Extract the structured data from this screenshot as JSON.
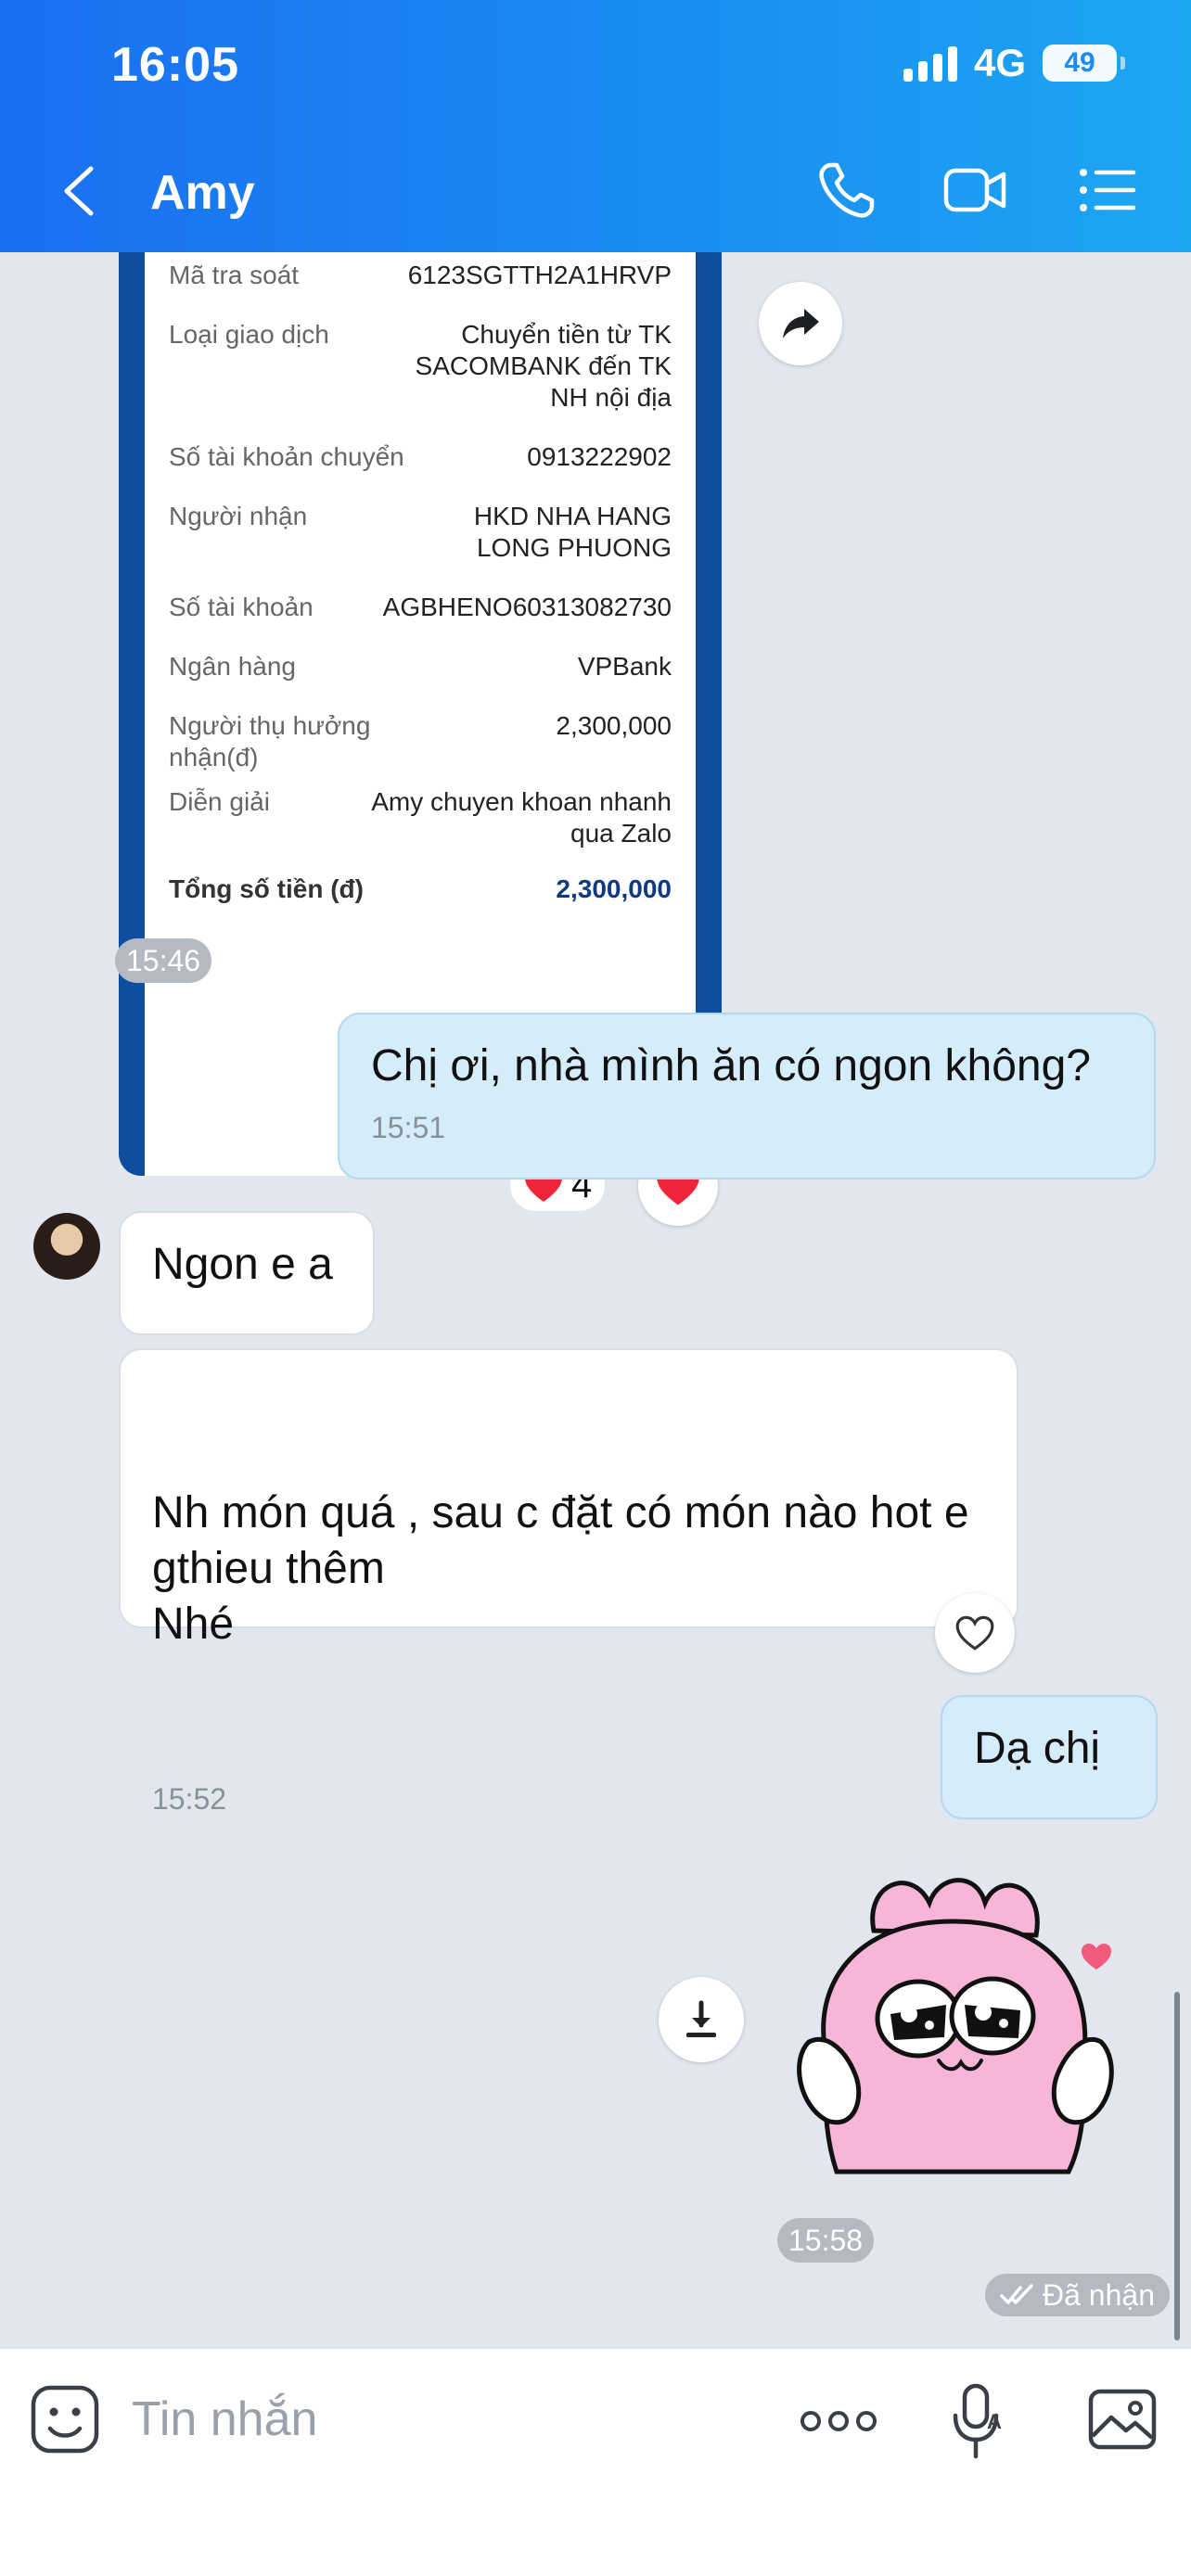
{
  "status_bar": {
    "time": "16:05",
    "network": "4G",
    "battery": "49"
  },
  "header": {
    "title": "Amy"
  },
  "receipt": {
    "rows": [
      {
        "label": "Mã tra soát",
        "value": "6123SGTTH2A1HRVP"
      },
      {
        "label": "Loại giao dịch",
        "value": "Chuyển tiền từ TK SACOMBANK đến TK NH nội địa"
      },
      {
        "label": "Số tài khoản chuyển",
        "value": "0913222902"
      },
      {
        "label": "Người nhận",
        "value": "HKD NHA HANG LONG PHUONG"
      },
      {
        "label": "Số tài khoản",
        "value": "AGBHENO60313082730"
      },
      {
        "label": "Ngân hàng",
        "value": "VPBank"
      },
      {
        "label": "Người thụ hưởng nhận(đ)",
        "value": "2,300,000"
      },
      {
        "label": "Diễn giải",
        "value": "Amy chuyen khoan nhanh qua Zalo"
      },
      {
        "label": "Tổng số tiền (đ)",
        "value": "2,300,000"
      }
    ],
    "reaction_count": "4",
    "time": "15:46"
  },
  "messages": [
    {
      "text": "Chị ơi, nhà mình ăn có ngon không?",
      "time": "15:51"
    },
    {
      "text": "Ngon e a"
    },
    {
      "text": "Nh món quá , sau c đặt có món nào hot e gthieu thêm\nNhé",
      "time": "15:52"
    },
    {
      "text": "Dạ chị"
    }
  ],
  "sticker": {
    "time": "15:58"
  },
  "delivery_status": "Đã nhận",
  "composer": {
    "placeholder": "Tin nhắn"
  },
  "colors": {
    "header_start": "#1a6ff0",
    "header_end": "#1ca7f1",
    "outgoing_bubble": "#d5ecfb",
    "incoming_bubble": "#ffffff",
    "chat_background": "#e2e6ee",
    "receipt_blue": "#0e4da0",
    "heart": "#f0253a",
    "sticker_pink": "#f7b6d8"
  },
  "icons": [
    "back-icon",
    "phone-icon",
    "video-icon",
    "menu-icon",
    "forward-icon",
    "heart-icon",
    "download-icon",
    "double-check-icon",
    "emoji-icon",
    "more-icon",
    "voice-icon",
    "image-icon"
  ]
}
